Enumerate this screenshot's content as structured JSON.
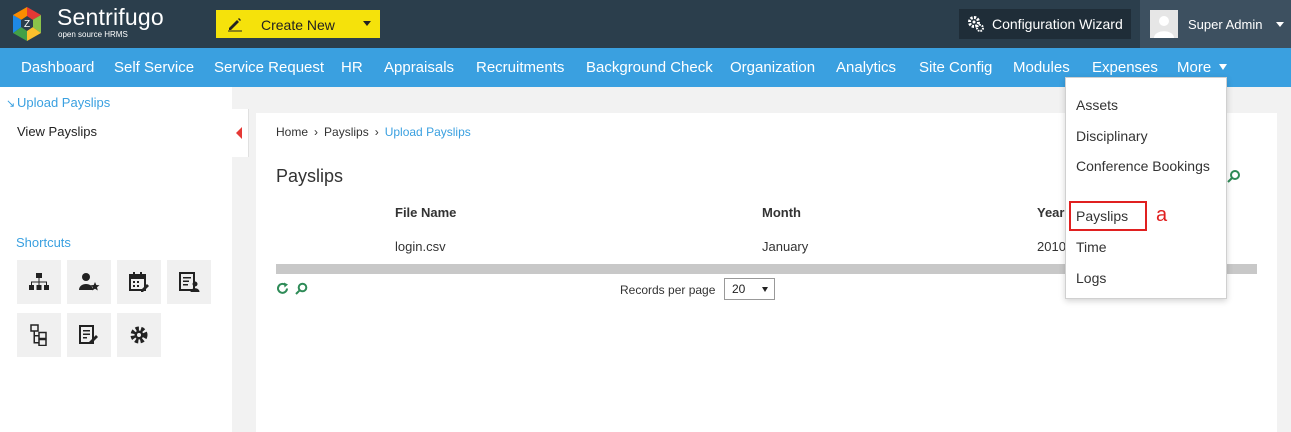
{
  "header": {
    "brand": "Sentrifugo",
    "brand_sub": "open source HRMS",
    "create_new": "Create New",
    "config_wizard": "Configuration Wizard",
    "user_name": "Super Admin"
  },
  "nav": {
    "items": [
      "Dashboard",
      "Self Service",
      "Service Request",
      "HR",
      "Appraisals",
      "Recruitments",
      "Background Check",
      "Organization",
      "Analytics",
      "Site Config",
      "Modules",
      "Expenses",
      "More"
    ]
  },
  "sidebar": {
    "active_item": "Upload Payslips",
    "link": "View Payslips",
    "shortcuts_title": "Shortcuts",
    "shortcut_icons": [
      "org-chart-icon",
      "user-star-icon",
      "calendar-edit-icon",
      "id-card-icon",
      "document-tree-icon",
      "document-edit-icon",
      "gear-icon"
    ]
  },
  "breadcrumb": [
    "Home",
    "Payslips",
    "Upload Payslips"
  ],
  "page": {
    "title": "Payslips"
  },
  "table": {
    "columns": [
      "File Name",
      "Month",
      "Year"
    ],
    "rows": [
      [
        "login.csv",
        "January",
        "2010"
      ]
    ]
  },
  "pager": {
    "records_label": "Records per page",
    "records_value": "20"
  },
  "more_menu": {
    "items": [
      "Assets",
      "Disciplinary",
      "Conference Bookings",
      "Payslips",
      "Time",
      "Logs"
    ]
  },
  "annotation": "a",
  "colors": {
    "topbar": "#2b3e4c",
    "nav": "#3aa0e0",
    "create_button": "#f5e20b",
    "accent_red": "#e02020"
  }
}
